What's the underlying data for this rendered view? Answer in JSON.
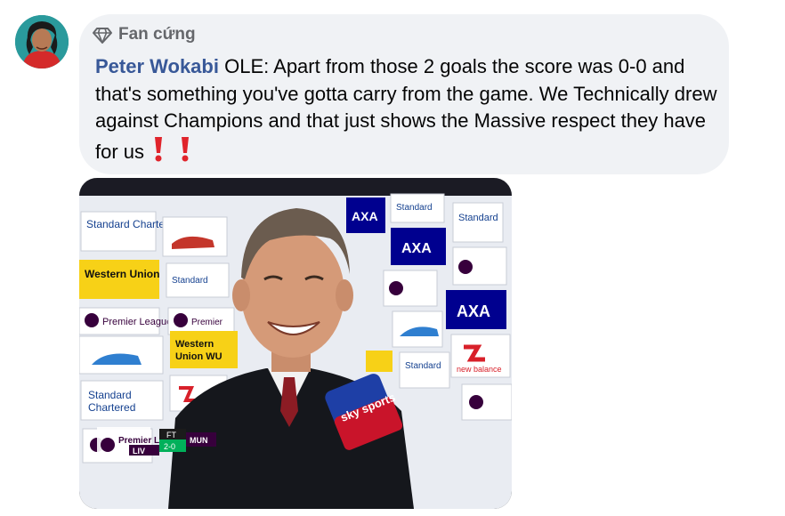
{
  "comment": {
    "badge": {
      "icon": "diamond-icon",
      "label": "Fan cứng"
    },
    "author": "Peter Wokabi",
    "body": "OLE: Apart from those 2 goals the score was 0-0 and that's something you've gotta carry from the game. We Technically drew against Champions and that just shows the Massive respect they have for us",
    "emoji": [
      "exclamation-mark-icon",
      "exclamation-mark-icon"
    ]
  },
  "photo": {
    "board_texts": {
      "standard_chartered": "Standard Chartered",
      "premier_league": "Premier League",
      "western_union": "Western Union",
      "axa": "AXA",
      "new_balance": "new balance",
      "sky_sports": "sky sports"
    },
    "scoreboard": {
      "home": "LIV",
      "status": "FT",
      "score": "2-0",
      "away": "MUN",
      "competition": "Premier League"
    }
  },
  "colors": {
    "bubble_bg": "#f0f2f5",
    "author": "#385898",
    "badge_text": "#65676b",
    "text": "#050505"
  }
}
